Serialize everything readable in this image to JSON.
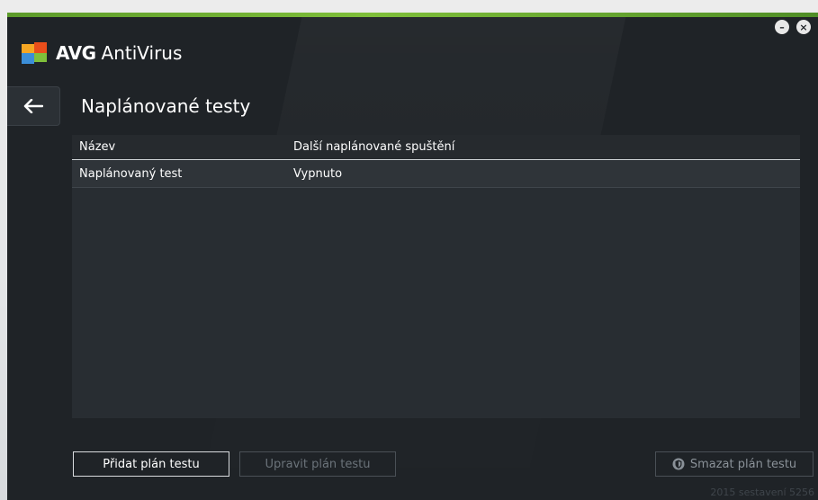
{
  "window": {
    "brand": "AVG",
    "app_name": "AntiVirus",
    "minimize_symbol": "–",
    "close_symbol": "×"
  },
  "page": {
    "title": "Naplánované testy"
  },
  "table": {
    "columns": [
      "Název",
      "Další naplánované spuštění"
    ],
    "rows": [
      {
        "name": "Naplánovaný test",
        "next_run": "Vypnuto"
      }
    ]
  },
  "buttons": {
    "add": "Přidat plán testu",
    "edit": "Upravit plán testu",
    "delete": "Smazat plán testu"
  },
  "footer": {
    "build": "2015 sestavení 5256"
  },
  "colors": {
    "accent_green": "#7fbf3a",
    "window_bg": "#1f2327",
    "table_bg": "#282d32"
  },
  "icons": {
    "logo": "avg-logo-icon",
    "back": "arrow-left-icon",
    "delete": "shield-icon"
  }
}
